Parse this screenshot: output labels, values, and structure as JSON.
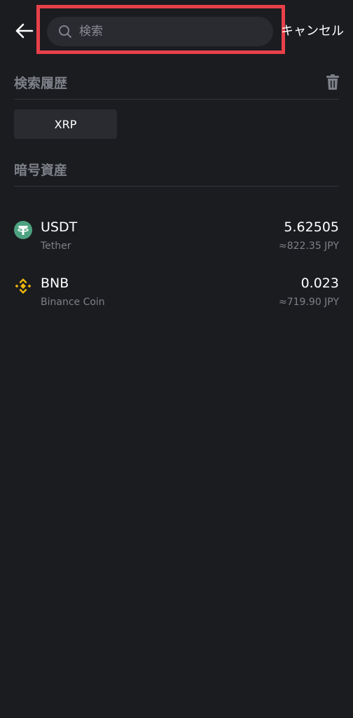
{
  "header": {
    "search_placeholder": "検索",
    "cancel_label": "キャンセル"
  },
  "history": {
    "title": "検索履歴",
    "items": [
      "XRP"
    ]
  },
  "assets": {
    "title": "暗号資産",
    "items": [
      {
        "symbol": "USDT",
        "name": "Tether",
        "amount": "5.62505",
        "fiat": "≈822.35 JPY",
        "icon": "tether-icon",
        "color": "#4da281"
      },
      {
        "symbol": "BNB",
        "name": "Binance Coin",
        "amount": "0.023",
        "fiat": "≈719.90 JPY",
        "icon": "binance-icon",
        "color": "#f0b90b"
      }
    ]
  },
  "colors": {
    "background": "#1b1c20",
    "highlight": "#e8404a"
  }
}
